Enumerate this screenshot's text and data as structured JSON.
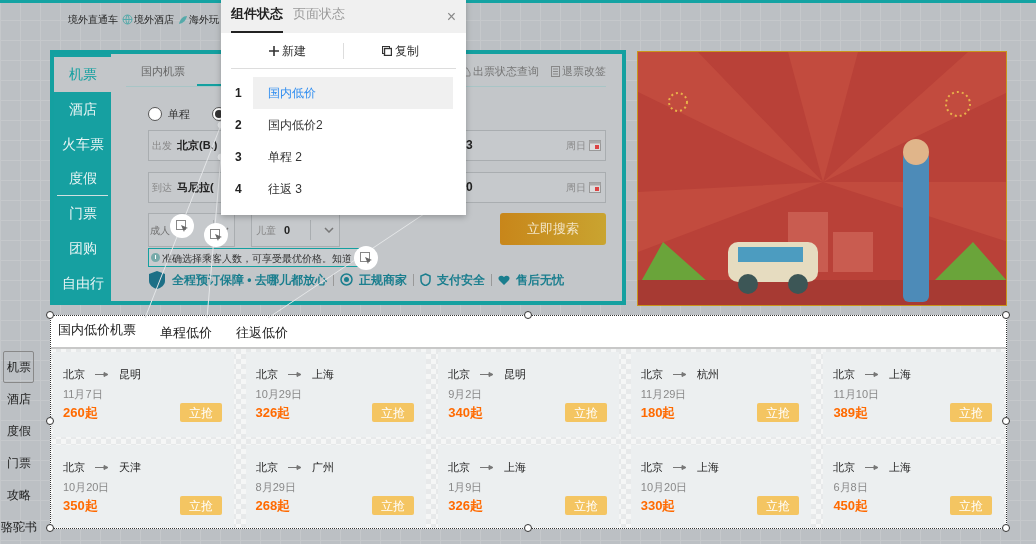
{
  "top_links": [
    {
      "label": "境外直通车"
    },
    {
      "label": "境外酒店"
    },
    {
      "label": "海外玩"
    }
  ],
  "search_widget": {
    "categories": [
      {
        "label": "机票",
        "selected": true
      },
      {
        "label": "酒店",
        "selected": false
      },
      {
        "label": "火车票",
        "selected": false
      },
      {
        "label": "度假",
        "selected": false
      },
      {
        "label": "门票",
        "selected": false
      },
      {
        "label": "团购",
        "selected": false
      },
      {
        "label": "自由行",
        "selected": false
      }
    ],
    "tabs": [
      {
        "label": "国内机票",
        "selected": false
      }
    ],
    "links": [
      "出票状态查询",
      "退票改签"
    ],
    "trip_types": [
      {
        "label": "单程",
        "selected": false
      },
      {
        "selected": true
      }
    ],
    "from": {
      "label": "出发",
      "value": "北京(B.)",
      "date": "3",
      "weekday": "周日"
    },
    "to": {
      "label": "到达",
      "value": "马尼拉(",
      "date": "0",
      "weekday": "周日"
    },
    "adults": {
      "label": "成人"
    },
    "children": {
      "label": "儿童",
      "value": "0"
    },
    "search_button": "立即搜索",
    "tip": "准确选择乘客人数，可享受最优价格。知道",
    "guarantees": [
      "全程预订保障 • 去哪儿都放心",
      "正规商家",
      "支付安全",
      "售后无忧"
    ]
  },
  "popup": {
    "tabs": [
      {
        "label": "组件状态",
        "selected": true
      },
      {
        "label": "页面状态",
        "selected": false
      }
    ],
    "close": "×",
    "actions": [
      "新建",
      "复制"
    ],
    "states": [
      {
        "number": "1",
        "label": "国内低价",
        "selected": true
      },
      {
        "number": "2",
        "label": "国内低价2",
        "selected": false
      },
      {
        "number": "3",
        "label": "单程 2",
        "selected": false
      },
      {
        "number": "4",
        "label": "往返 3",
        "selected": false
      }
    ]
  },
  "side_nav": [
    {
      "label": "机票",
      "selected": true
    },
    {
      "label": "酒店",
      "selected": false
    },
    {
      "label": "度假",
      "selected": false
    },
    {
      "label": "门票",
      "selected": false
    },
    {
      "label": "攻略",
      "selected": false
    },
    {
      "label": "骆驼书",
      "selected": false
    }
  ],
  "deals": {
    "tabs": [
      "国内低价机票",
      "单程低价",
      "往返低价"
    ],
    "cards": [
      {
        "from": "北京",
        "to": "昆明",
        "date": "11月7日",
        "price": "260起",
        "button": "立抢"
      },
      {
        "from": "北京",
        "to": "上海",
        "date": "10月29日",
        "price": "326起",
        "button": "立抢"
      },
      {
        "from": "北京",
        "to": "昆明",
        "date": "9月2日",
        "price": "340起",
        "button": "立抢"
      },
      {
        "from": "北京",
        "to": "杭州",
        "date": "11月29日",
        "price": "180起",
        "button": "立抢"
      },
      {
        "from": "北京",
        "to": "上海",
        "date": "11月10日",
        "price": "389起",
        "button": "立抢"
      },
      {
        "from": "北京",
        "to": "天津",
        "date": "10月20日",
        "price": "350起",
        "button": "立抢"
      },
      {
        "from": "北京",
        "to": "广州",
        "date": "8月29日",
        "price": "268起",
        "button": "立抢"
      },
      {
        "from": "北京",
        "to": "上海",
        "date": "1月9日",
        "price": "326起",
        "button": "立抢"
      },
      {
        "from": "北京",
        "to": "上海",
        "date": "10月20日",
        "price": "330起",
        "button": "立抢"
      },
      {
        "from": "北京",
        "to": "上海",
        "date": "6月8日",
        "price": "450起",
        "button": "立抢"
      }
    ]
  }
}
